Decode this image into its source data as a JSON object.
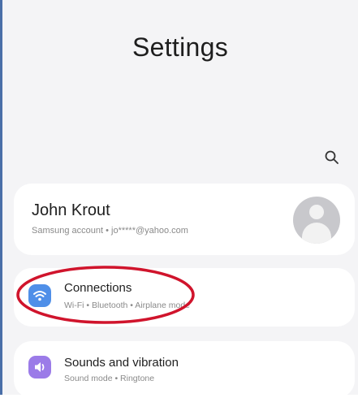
{
  "header": {
    "title": "Settings"
  },
  "search": {
    "icon": "search-icon"
  },
  "profile": {
    "name": "John Krout",
    "account": "Samsung account • jo*****@yahoo.com"
  },
  "items": [
    {
      "title": "Connections",
      "subtitle": "Wi-Fi • Bluetooth • Airplane mode",
      "icon": "wifi-icon",
      "color": "#4f8fe8"
    },
    {
      "title": "Sounds and vibration",
      "subtitle": "Sound mode • Ringtone",
      "icon": "volume-icon",
      "color": "#9b7be8"
    }
  ],
  "annotation": {
    "color": "#d0142c",
    "shape": "ellipse around Connections"
  }
}
